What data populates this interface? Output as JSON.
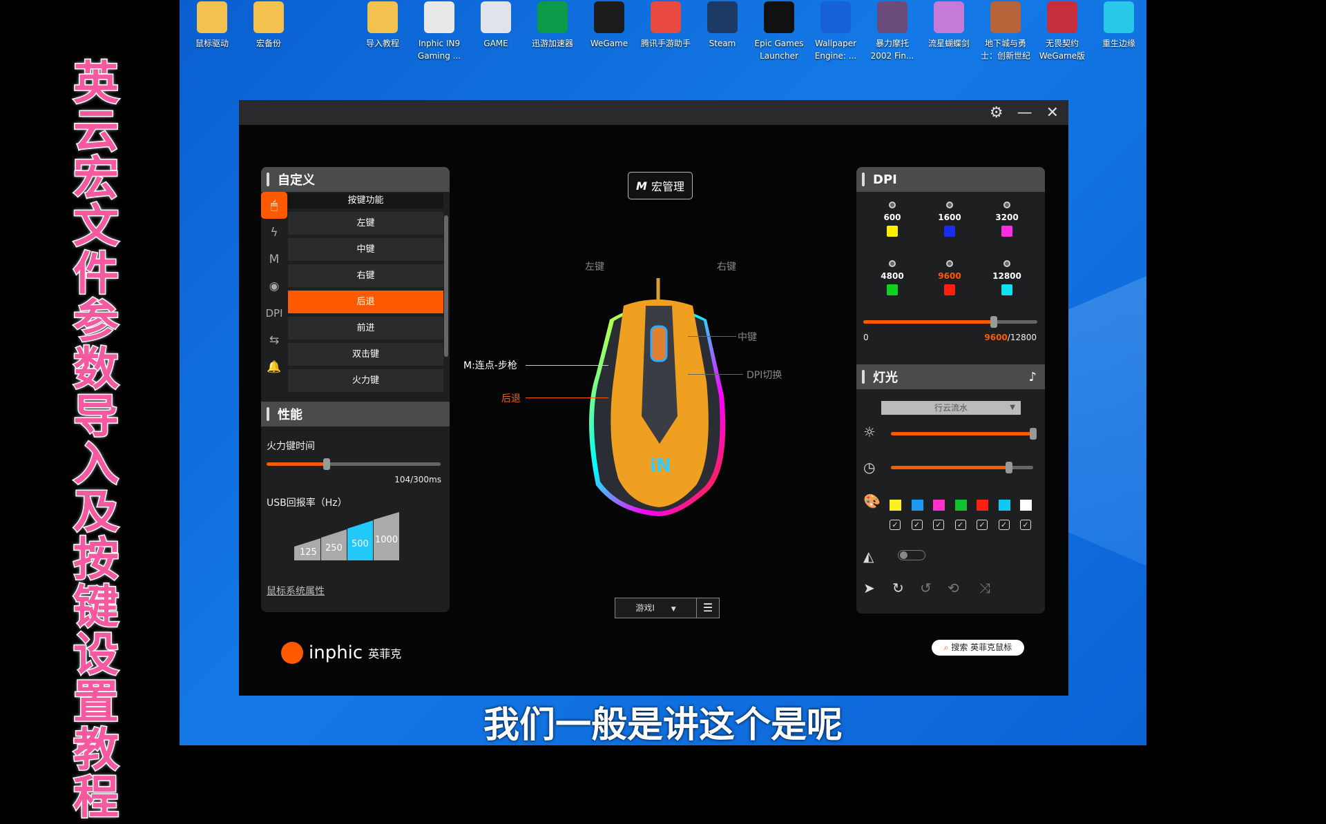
{
  "desktop": {
    "icons": [
      {
        "label": "鼠标驱动",
        "color": "#f2c14e"
      },
      {
        "label": "宏备份",
        "color": "#f2c14e"
      },
      {
        "label": "导入教程",
        "color": "#f2c14e"
      },
      {
        "label": "Inphic IN9 Gaming ...",
        "color": "#e8e8e8"
      },
      {
        "label": "GAME",
        "color": "#dfe3ea"
      },
      {
        "label": "迅游加速器",
        "color": "#0b9a4a"
      },
      {
        "label": "WeGame",
        "color": "#1c1c1c"
      },
      {
        "label": "腾讯手游助手",
        "color": "#e94a3f"
      },
      {
        "label": "Steam",
        "color": "#1b3a64"
      },
      {
        "label": "Epic Games Launcher",
        "color": "#111111"
      },
      {
        "label": "Wallpaper Engine: ...",
        "color": "#1660d8"
      },
      {
        "label": "暴力摩托 2002 Fin...",
        "color": "#6a4b7a"
      },
      {
        "label": "流星蝴蝶剑",
        "color": "#c57ad8"
      },
      {
        "label": "地下城与勇士：创新世纪",
        "color": "#b7643b"
      },
      {
        "label": "无畏契约 WeGame版",
        "color": "#c62e3c"
      },
      {
        "label": "重生边缘",
        "color": "#28c8e8"
      }
    ]
  },
  "overlay": {
    "vertical_title": "英云宏文件参数导入及按键设置教程",
    "subtitle": "我们一般是讲这个是呢"
  },
  "titlebar": {
    "icons": [
      "gear-icon",
      "minimize-icon",
      "close-icon"
    ]
  },
  "custom": {
    "title": "自定义",
    "side_icons": [
      "mouse-icon",
      "lightning-icon",
      "macro-m-icon",
      "record-icon",
      "DPI",
      "swap-icon",
      "bell-icon"
    ],
    "list_header": "按键功能",
    "items": [
      "左键",
      "中键",
      "右键",
      "后退",
      "前进",
      "双击键",
      "火力键"
    ],
    "selected": "后退"
  },
  "performance": {
    "title": "性能",
    "fire_label": "火力键时间",
    "fire_value": "104/300ms",
    "fire_fraction": 0.347,
    "usb_label": "USB回报率（Hz）",
    "rates": [
      "125",
      "250",
      "500",
      "1000"
    ],
    "selected_rate": "500",
    "link": "鼠标系统属性"
  },
  "center": {
    "macro_button": "宏管理",
    "macro_icon": "M",
    "labels": {
      "left": "左键",
      "right": "右键",
      "middle": "中键",
      "dpi": "DPI切换",
      "m": "M:连点-步枪",
      "back": "后退"
    },
    "profile": "游戏I",
    "menu_icon": "menu-icon"
  },
  "brand": {
    "logo": "inphic",
    "logo_cn": "英菲克",
    "search": "搜索 英菲克鼠标"
  },
  "dpi": {
    "title": "DPI",
    "levels": [
      {
        "v": "600",
        "c": "#ffee00"
      },
      {
        "v": "1600",
        "c": "#1a2cf0"
      },
      {
        "v": "3200",
        "c": "#ff2ee0"
      },
      {
        "v": "4800",
        "c": "#10d020"
      },
      {
        "v": "9600",
        "c": "#ff2010",
        "active": true
      },
      {
        "v": "12800",
        "c": "#10e0f0"
      }
    ],
    "min": "0",
    "current": "9600",
    "max": "/12800",
    "fraction": 0.75,
    "accent": "#ff5a00"
  },
  "light": {
    "title": "灯光",
    "mode": "行云流水",
    "brightness": 1.0,
    "speed": 0.83,
    "colors": [
      "#ffee22",
      "#1a9af0",
      "#ff33cc",
      "#10c030",
      "#ff2010",
      "#10c8f0",
      "#ffffff"
    ],
    "toggle": false
  }
}
